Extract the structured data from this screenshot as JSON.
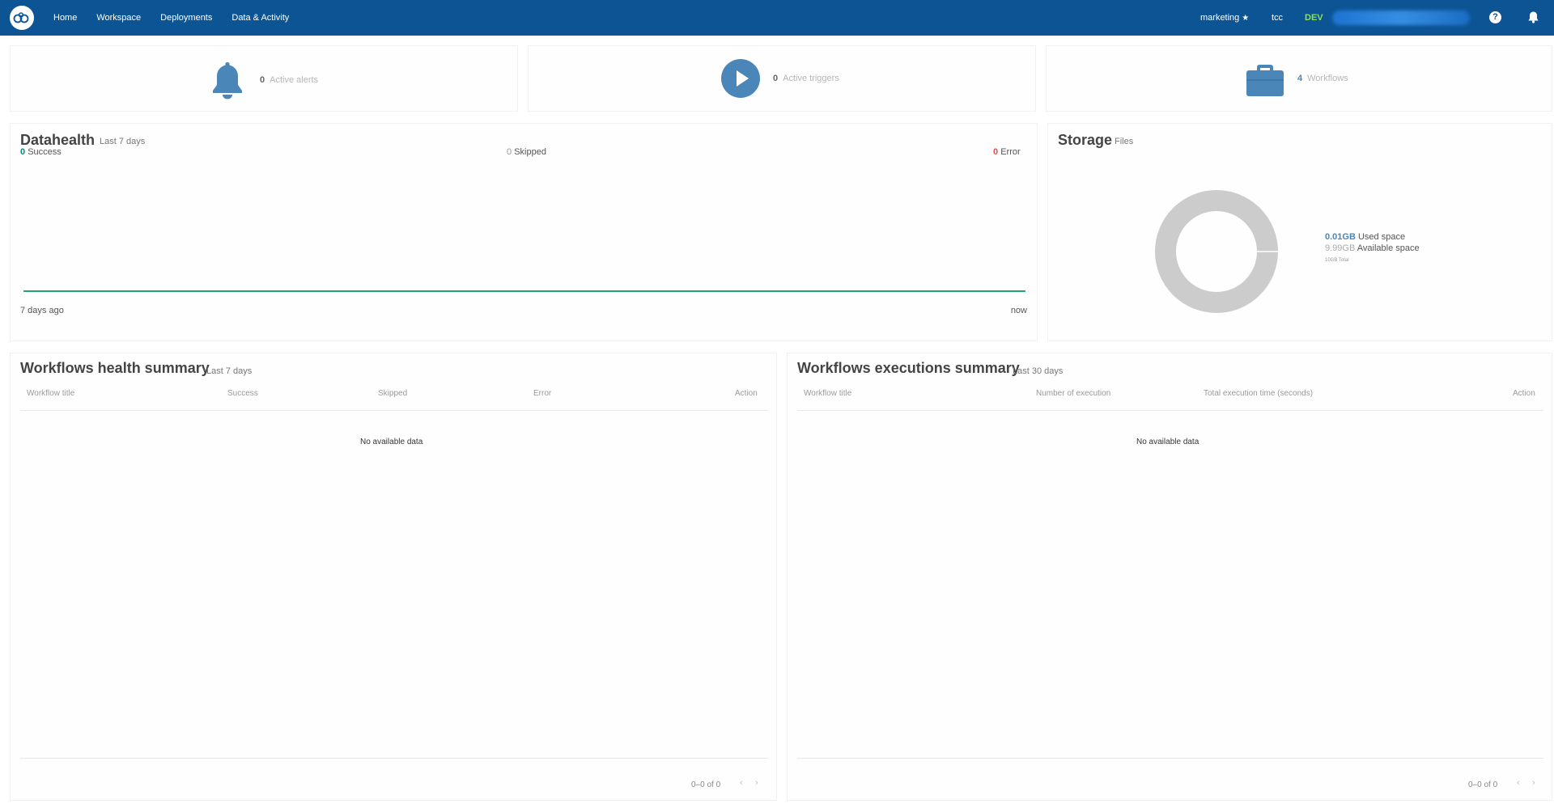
{
  "nav": {
    "items": [
      "Home",
      "Workspace",
      "Deployments",
      "Data & Activity"
    ],
    "workspace": "marketing",
    "user": "tcc",
    "env": "DEV",
    "help": "?"
  },
  "stats": {
    "alerts": {
      "count": "0",
      "label": "Active alerts"
    },
    "triggers": {
      "count": "0",
      "label": "Active triggers"
    },
    "workflows": {
      "count": "4",
      "label": "Workflows"
    }
  },
  "datahealth": {
    "title": "Datahealth",
    "subtitle": "Last 7 days",
    "success_count": "0",
    "success_label": "Success",
    "skipped_count": "0",
    "skipped_label": "Skipped",
    "error_count": "0",
    "error_label": "Error",
    "start_label": "7 days ago",
    "end_label": "now",
    "line_color": "#23a36a"
  },
  "storage": {
    "title": "Storage",
    "subtitle": "Files",
    "used_value": "0.01GB",
    "used_label": "Used space",
    "available_value": "9.99GB",
    "available_label": "Available space",
    "total": "10GB Total",
    "used_fraction": 0.001
  },
  "health_summary": {
    "title": "Workflows health summary",
    "subtitle": "Last 7 days",
    "columns": [
      "Workflow title",
      "Success",
      "Skipped",
      "Error",
      "Action"
    ],
    "empty": "No available data",
    "pagination": "0–0 of 0"
  },
  "exec_summary": {
    "title": "Workflows executions summary",
    "subtitle": "Last 30 days",
    "columns": [
      "Workflow title",
      "Number of execution",
      "Total execution time (seconds)",
      "Action"
    ],
    "empty": "No available data",
    "pagination": "0–0 of 0"
  },
  "colors": {
    "nav_bg": "#0c5494",
    "icon_blue": "#4b86b8",
    "donut": "#cccccc"
  }
}
